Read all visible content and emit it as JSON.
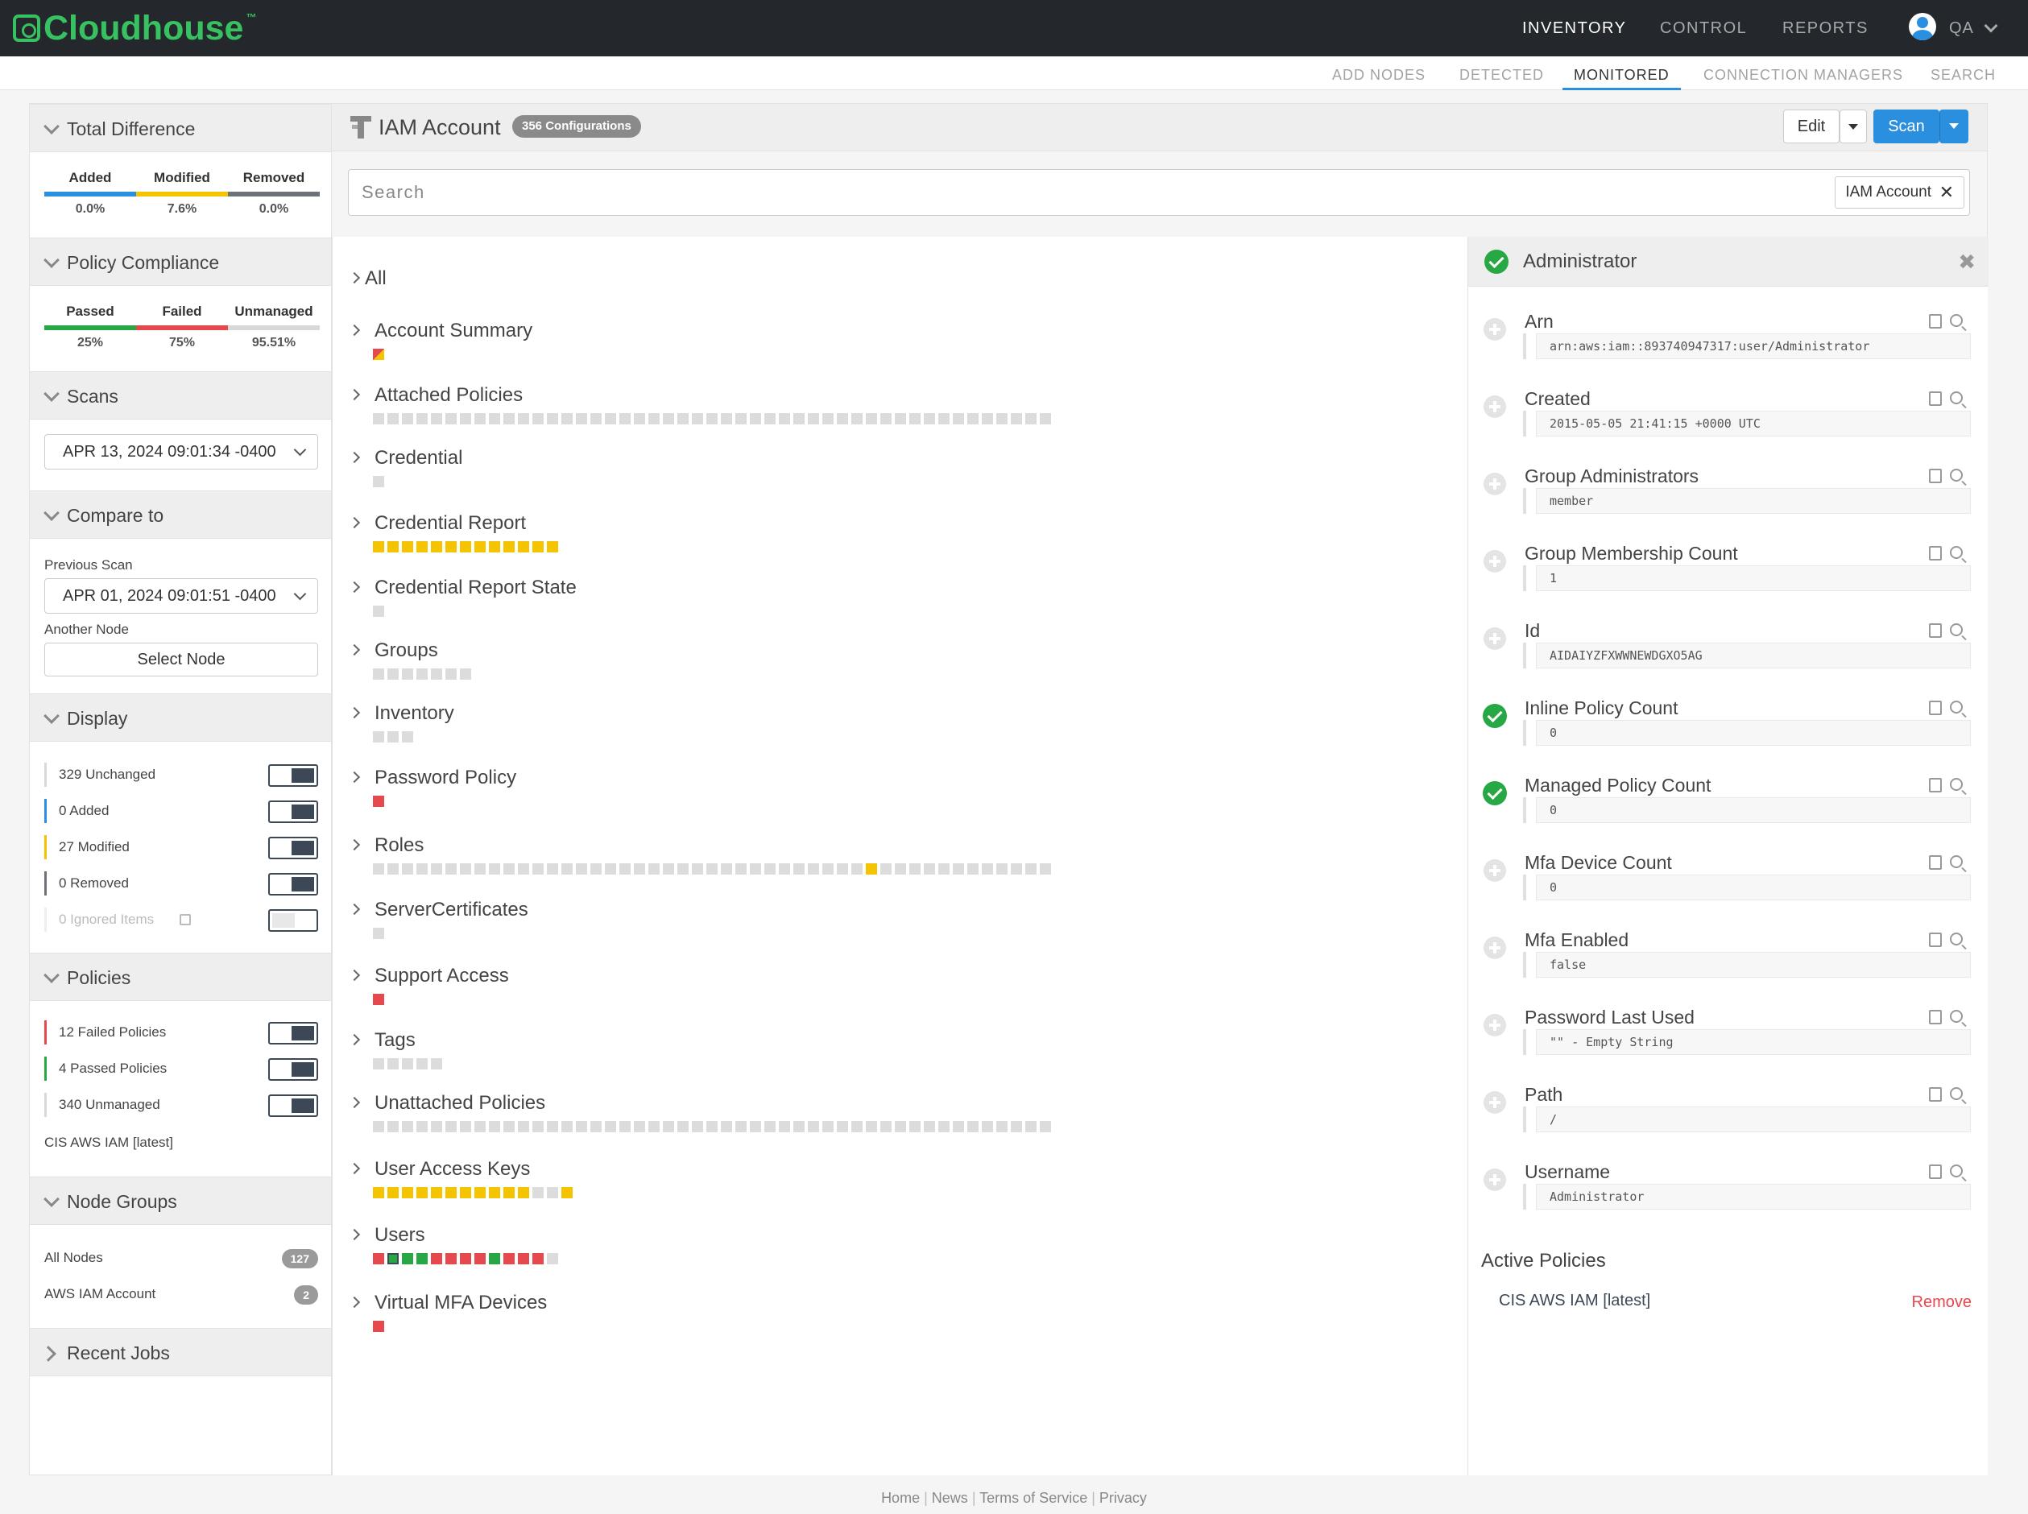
{
  "brand": {
    "name": "Cloudhouse",
    "tm": "™",
    "color": "#38c161"
  },
  "nav": {
    "items": [
      "INVENTORY",
      "CONTROL",
      "REPORTS"
    ],
    "active": "INVENTORY",
    "user": "QA"
  },
  "subnav": {
    "items": [
      "ADD NODES",
      "DETECTED",
      "MONITORED",
      "CONNECTION MANAGERS",
      "SEARCH"
    ],
    "active": "MONITORED"
  },
  "sidebar": {
    "total_difference": {
      "title": "Total Difference",
      "stats": [
        {
          "label": "Added",
          "value": "0.0%",
          "color": "#2b8fe0"
        },
        {
          "label": "Modified",
          "value": "7.6%",
          "color": "#f5c400"
        },
        {
          "label": "Removed",
          "value": "0.0%",
          "color": "#6d7178"
        }
      ]
    },
    "policy_compliance": {
      "title": "Policy Compliance",
      "stats": [
        {
          "label": "Passed",
          "value": "25%",
          "color": "#28a745"
        },
        {
          "label": "Failed",
          "value": "75%",
          "color": "#e5484d"
        },
        {
          "label": "Unmanaged",
          "value": "95.51%",
          "color": "#d8d8d8"
        }
      ]
    },
    "scans": {
      "title": "Scans",
      "selected": "APR 13, 2024 09:01:34 -0400"
    },
    "compare": {
      "title": "Compare to",
      "previous_label": "Previous Scan",
      "previous_value": "APR 01, 2024 09:01:51 -0400",
      "another_label": "Another Node",
      "select_node": "Select Node"
    },
    "display": {
      "title": "Display",
      "rows": [
        {
          "label": "329 Unchanged",
          "color": "#d8d8d8",
          "on": true
        },
        {
          "label": "0 Added",
          "color": "#2b8fe0",
          "on": true
        },
        {
          "label": "27 Modified",
          "color": "#f5c400",
          "on": true
        },
        {
          "label": "0 Removed",
          "color": "#6d7178",
          "on": true
        },
        {
          "label": "0 Ignored Items",
          "color": "#eeeeee",
          "on": false
        }
      ]
    },
    "policies": {
      "title": "Policies",
      "rows": [
        {
          "label": "12 Failed Policies",
          "color": "#e5484d",
          "on": true
        },
        {
          "label": "4 Passed Policies",
          "color": "#28a745",
          "on": true
        },
        {
          "label": "340 Unmanaged",
          "color": "#d8d8d8",
          "on": true
        }
      ],
      "policy_name": "CIS AWS IAM [latest]"
    },
    "node_groups": {
      "title": "Node Groups",
      "items": [
        {
          "label": "All Nodes",
          "count": "127"
        },
        {
          "label": "AWS IAM Account",
          "count": "2"
        }
      ]
    },
    "recent_jobs": {
      "title": "Recent Jobs"
    }
  },
  "main": {
    "title": "IAM Account",
    "config_badge": "356 Configurations",
    "edit_label": "Edit",
    "scan_label": "Scan",
    "search_placeholder": "Search",
    "filter_chip": "IAM Account",
    "tree_items": [
      {
        "name": "All",
        "cells": []
      },
      {
        "name": "Account Summary",
        "cells": [
          "m"
        ]
      },
      {
        "name": "Attached Policies",
        "cells": [
          "u*47"
        ]
      },
      {
        "name": "Credential",
        "cells": [
          "u"
        ]
      },
      {
        "name": "Credential Report",
        "cells": [
          "y*13"
        ]
      },
      {
        "name": "Credential Report State",
        "cells": [
          "u"
        ]
      },
      {
        "name": "Groups",
        "cells": [
          "u*7"
        ]
      },
      {
        "name": "Inventory",
        "cells": [
          "u*3"
        ]
      },
      {
        "name": "Password Policy",
        "cells": [
          "r"
        ]
      },
      {
        "name": "Roles",
        "cells": [
          "u*34",
          "y",
          "u*12"
        ]
      },
      {
        "name": "ServerCertificates",
        "cells": [
          "u"
        ]
      },
      {
        "name": "Support Access",
        "cells": [
          "r"
        ]
      },
      {
        "name": "Tags",
        "cells": [
          "u*5"
        ]
      },
      {
        "name": "Unattached Policies",
        "cells": [
          "u*47"
        ]
      },
      {
        "name": "User Access Keys",
        "cells": [
          "y*11",
          "u*2",
          "y"
        ]
      },
      {
        "name": "Users",
        "cells": [
          "r",
          "gs",
          "g",
          "g",
          "r",
          "r",
          "r",
          "r",
          "g",
          "r",
          "r",
          "r",
          "u"
        ]
      },
      {
        "name": "Virtual MFA Devices",
        "cells": [
          "r"
        ]
      }
    ],
    "cell_colors": {
      "u": "#dcdcdc",
      "y": "#f5c400",
      "r": "#e5484d",
      "g": "#28a745",
      "m": "#f5c400"
    }
  },
  "detail": {
    "title": "Administrator",
    "properties": [
      {
        "name": "Arn",
        "value": "arn:aws:iam::893740947317:user/Administrator",
        "status": "none"
      },
      {
        "name": "Created",
        "value": "2015-05-05 21:41:15 +0000 UTC",
        "status": "none"
      },
      {
        "name": "Group Administrators",
        "value": "member",
        "status": "none"
      },
      {
        "name": "Group Membership Count",
        "value": "1",
        "status": "none"
      },
      {
        "name": "Id",
        "value": "AIDAIYZFXWWNEWDGXO5AG",
        "status": "none"
      },
      {
        "name": "Inline Policy Count",
        "value": "0",
        "status": "pass"
      },
      {
        "name": "Managed Policy Count",
        "value": "0",
        "status": "pass"
      },
      {
        "name": "Mfa Device Count",
        "value": "0",
        "status": "none"
      },
      {
        "name": "Mfa Enabled",
        "value": "false",
        "status": "none"
      },
      {
        "name": "Password Last Used",
        "value": "\"\" - Empty String",
        "status": "none"
      },
      {
        "name": "Path",
        "value": "/",
        "status": "none"
      },
      {
        "name": "Username",
        "value": "Administrator",
        "status": "none"
      }
    ],
    "active_policies_title": "Active Policies",
    "active_policy": "CIS AWS IAM [latest]",
    "remove_label": "Remove"
  },
  "footer": {
    "links": [
      "Home",
      "News",
      "Terms of Service",
      "Privacy"
    ]
  }
}
